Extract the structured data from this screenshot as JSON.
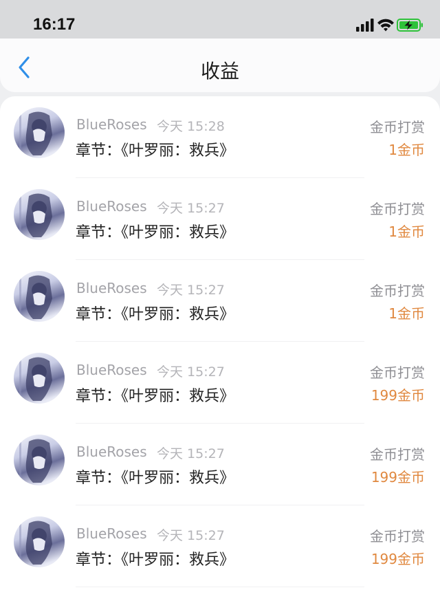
{
  "status_bar": {
    "time": "16:17"
  },
  "nav": {
    "title": "收益"
  },
  "records": [
    {
      "user": "BlueRoses",
      "time": "今天 15:28",
      "chapter": "章节：《叶罗丽：救兵》",
      "reward_type": "金币打赏",
      "amount": "1金币"
    },
    {
      "user": "BlueRoses",
      "time": "今天 15:27",
      "chapter": "章节：《叶罗丽：救兵》",
      "reward_type": "金币打赏",
      "amount": "1金币"
    },
    {
      "user": "BlueRoses",
      "time": "今天 15:27",
      "chapter": "章节：《叶罗丽：救兵》",
      "reward_type": "金币打赏",
      "amount": "1金币"
    },
    {
      "user": "BlueRoses",
      "time": "今天 15:27",
      "chapter": "章节：《叶罗丽：救兵》",
      "reward_type": "金币打赏",
      "amount": "199金币"
    },
    {
      "user": "BlueRoses",
      "time": "今天 15:27",
      "chapter": "章节：《叶罗丽：救兵》",
      "reward_type": "金币打赏",
      "amount": "199金币"
    },
    {
      "user": "BlueRoses",
      "time": "今天 15:27",
      "chapter": "章节：《叶罗丽：救兵》",
      "reward_type": "金币打赏",
      "amount": "199金币"
    }
  ],
  "colors": {
    "accent": "#2f8fe8",
    "amount": "#e0883f",
    "battery": "#2ec23a"
  }
}
